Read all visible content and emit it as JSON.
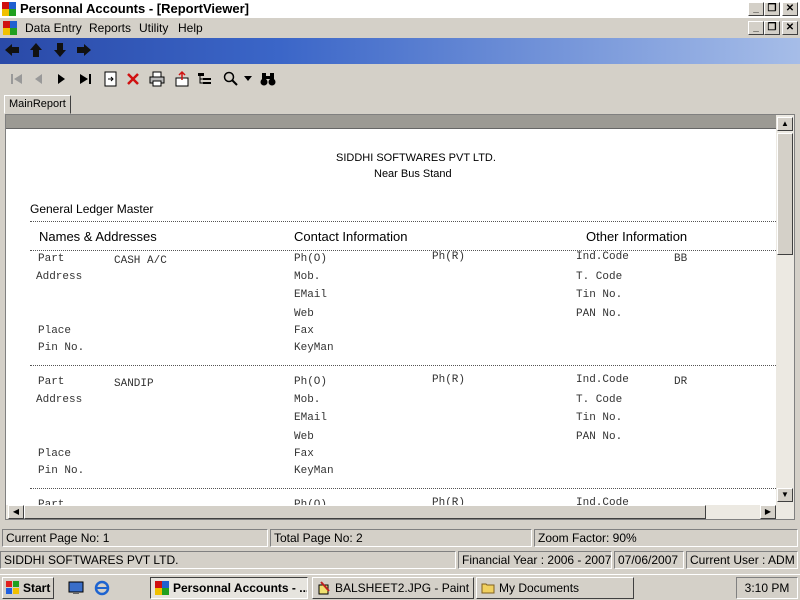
{
  "window": {
    "title": "Personnal Accounts - [ReportViewer]"
  },
  "menu": {
    "items": [
      "Data Entry",
      "Reports",
      "Utility",
      "Help"
    ]
  },
  "report_toolbar": {
    "icons": [
      "first-page-icon",
      "prev-page-icon",
      "next-page-icon",
      "last-page-icon",
      "goto-page-icon",
      "close-report-icon",
      "print-icon",
      "export-icon",
      "group-tree-icon",
      "zoom-icon",
      "search-binoculars-icon"
    ]
  },
  "tabs": {
    "main": "MainReport"
  },
  "report": {
    "company": "SIDDHI SOFTWARES PVT LTD.",
    "address": "Near Bus  Stand",
    "title": "General Ledger Master",
    "col_names": "Names & Addresses",
    "col_contact": "Contact Information",
    "col_other": "Other Information",
    "labels": {
      "part": "Part",
      "address": "Address",
      "place": "Place",
      "pin": "Pin No.",
      "pho": "Ph(O)",
      "mob": "Mob.",
      "email": "EMail",
      "web": "Web",
      "fax": "Fax",
      "keyman": "KeyMan",
      "phr": "Ph(R)",
      "indcode": "Ind.Code",
      "tcode": "T. Code",
      "tin": "Tin No.",
      "pan": "PAN No."
    },
    "records": [
      {
        "name": "CASH A/C",
        "ind_code": "BB"
      },
      {
        "name": "SANDIP",
        "ind_code": "DR"
      }
    ]
  },
  "status": {
    "current_page": "Current Page No: 1",
    "total_pages": "Total Page No: 2",
    "zoom": "Zoom Factor: 90%",
    "company": "SIDDHI SOFTWARES PVT LTD.",
    "financial_year": "Financial Year : 2006 - 2007",
    "date": "07/06/2007",
    "user": "Current User : ADM"
  },
  "taskbar": {
    "start": "Start",
    "tasks": [
      "Personnal Accounts - ...",
      "BALSHEET2.JPG - Paint",
      "My Documents"
    ],
    "clock": "3:10 PM"
  },
  "colors": {
    "nav_band": "#2a4aa8",
    "chrome": "#d4d0c8",
    "close_x": "#d01010"
  }
}
